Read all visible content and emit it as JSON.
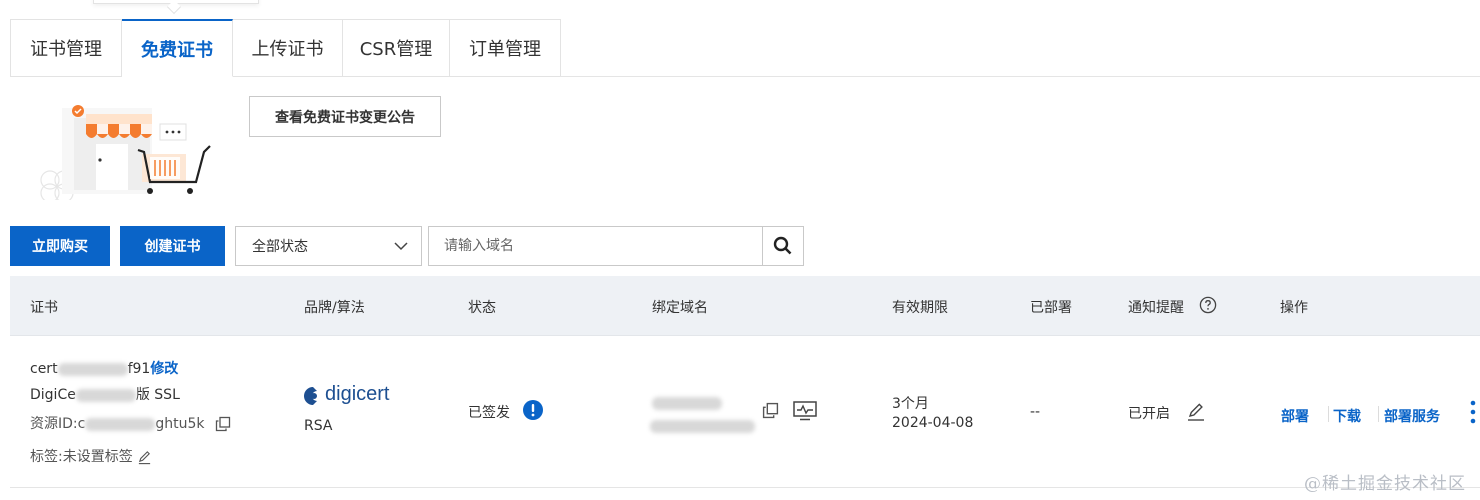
{
  "tabs": [
    {
      "label": "证书管理",
      "active": false
    },
    {
      "label": "免费证书",
      "active": true
    },
    {
      "label": "上传证书",
      "active": false
    },
    {
      "label": "CSR管理",
      "active": false
    },
    {
      "label": "订单管理",
      "active": false
    }
  ],
  "notice_button": "查看免费证书变更公告",
  "toolbar": {
    "buy_label": "立即购买",
    "create_label": "创建证书",
    "status_select": "全部状态",
    "search_placeholder": "请输入域名"
  },
  "table": {
    "headers": {
      "cert": "证书",
      "brand": "品牌/算法",
      "status": "状态",
      "domain": "绑定域名",
      "validity": "有效期限",
      "deployed": "已部署",
      "notify": "通知提醒",
      "actions": "操作"
    },
    "row": {
      "name_prefix": "cert",
      "name_suffix": "f91",
      "edit_label": "修改",
      "product_prefix": "DigiCe",
      "product_suffix": "版 SSL",
      "resource_prefix": "资源ID:c",
      "resource_suffix": "ghtu5k",
      "tag_label": "标签:未设置标签",
      "brand_logo": "digicert",
      "algorithm": "RSA",
      "status": "已签发",
      "validity_period": "3个月",
      "validity_date": "2024-04-08",
      "deployed": "--",
      "notify": "已开启",
      "actions": [
        "部署",
        "下载",
        "部署服务"
      ]
    }
  },
  "watermark": "@稀土掘金技术社区",
  "colors": {
    "primary": "#0a64c8",
    "header_bg": "#eef1f5",
    "digicert_blue": "#1d4f91"
  }
}
